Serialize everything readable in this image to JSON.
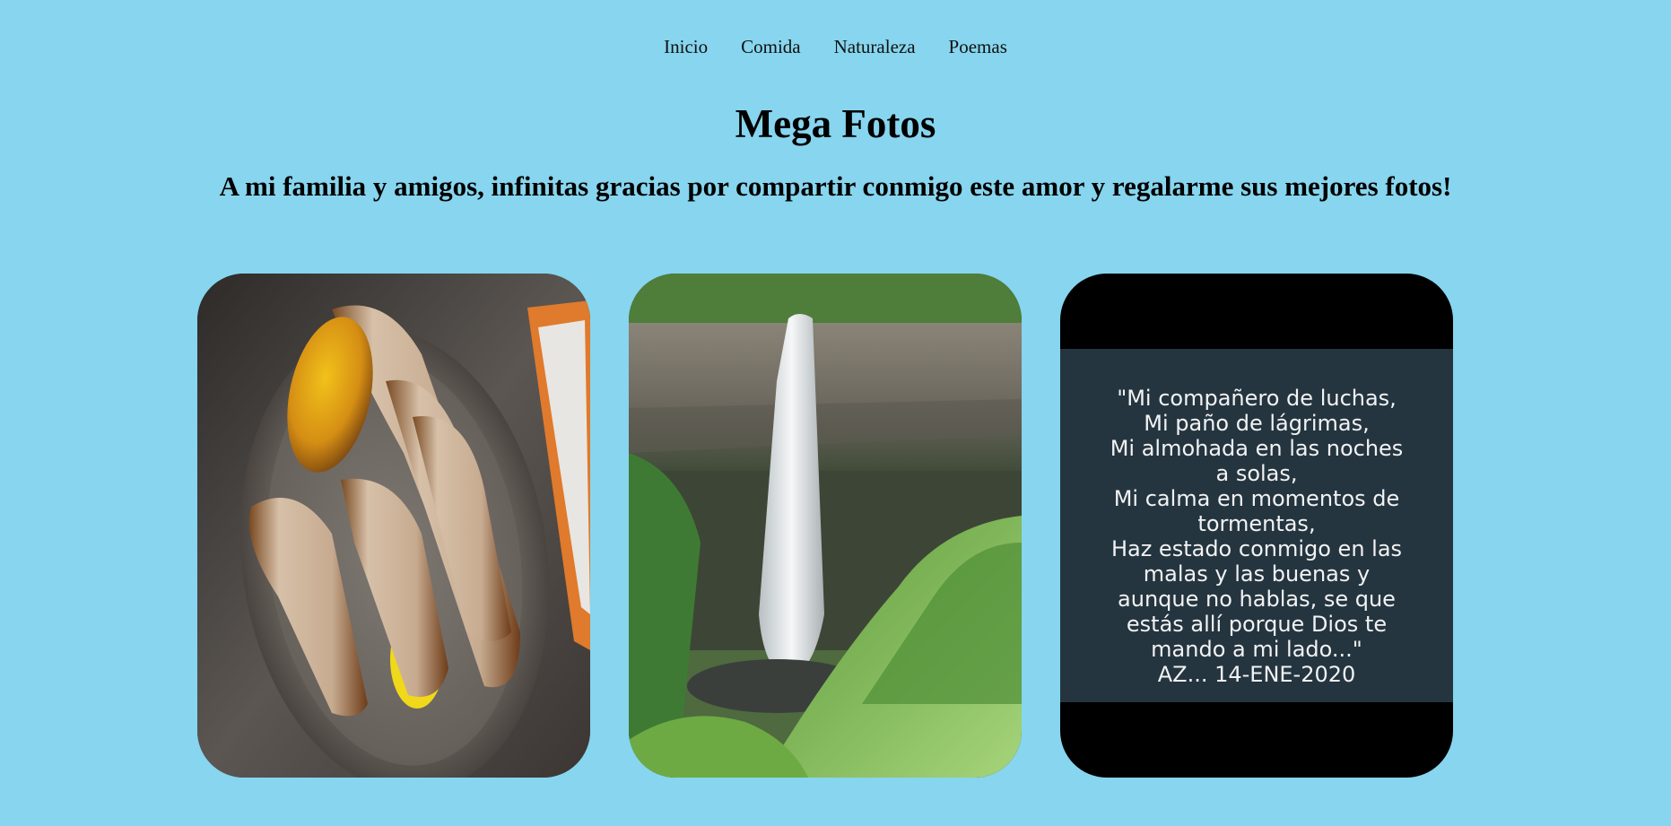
{
  "nav": {
    "items": [
      "Inicio",
      "Comida",
      "Naturaleza",
      "Poemas"
    ]
  },
  "header": {
    "title": "Mega Fotos",
    "subtitle": "A mi familia y amigos, infinitas gracias por compartir conmigo este amor y regalarme sus mejores fotos!"
  },
  "gallery": {
    "poem": {
      "lines": [
        "\"Mi compañero de luchas,",
        "Mi paño de lágrimas,",
        "Mi almohada en las noches",
        "a solas,",
        "Mi calma en momentos de",
        "tormentas,",
        "Haz estado conmigo en las",
        "malas y las buenas y",
        "aunque no hablas, se que",
        "estás allí porque Dios te",
        "mando a mi lado...\"",
        "AZ... 14-ENE-2020"
      ]
    }
  },
  "colors": {
    "page_background": "#87d5ee",
    "poem_panel": "#243540"
  }
}
